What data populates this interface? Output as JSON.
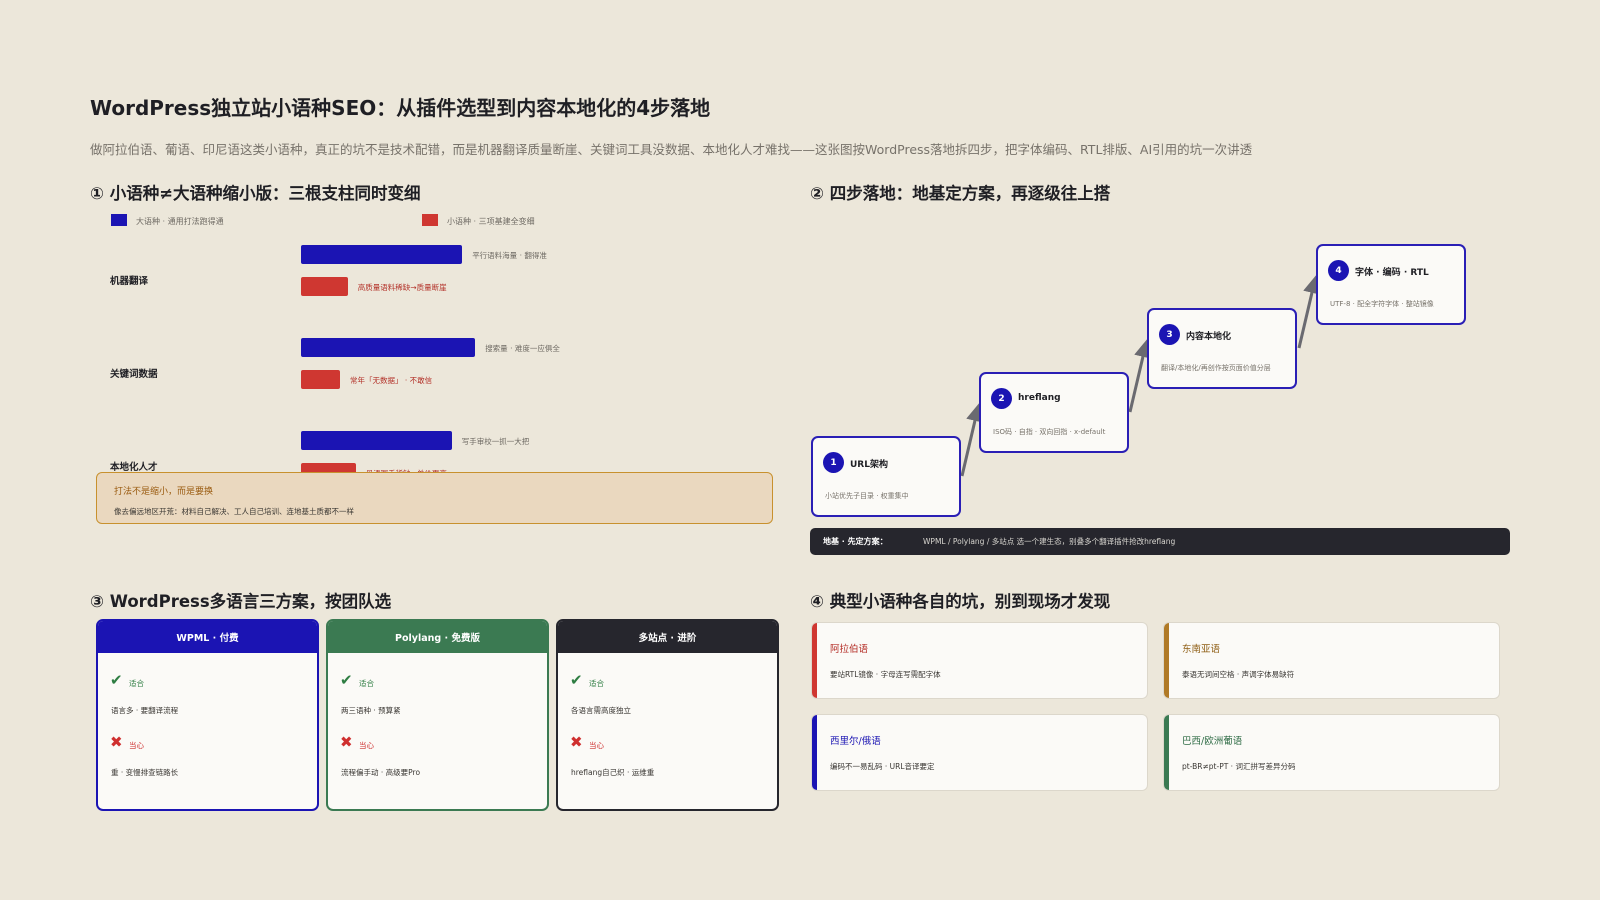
{
  "title": "WordPress独立站小语种SEO：从插件选型到内容本地化的4步落地",
  "subtitle": "做阿拉伯语、葡语、印尼语这类小语种，真正的坑不是技术配错，而是机器翻译质量断崖、关键词工具没数据、本地化人才难找——这张图按WordPress落地拆四步，把字体编码、RTL排版、AI引用的坑一次讲透",
  "colors": {
    "background": "#ece7da",
    "major": "#1b14b3",
    "minor": "#cf3731",
    "green": "#3b7a52",
    "dark": "#26262d",
    "amber": "#b07a26"
  },
  "section1": {
    "heading": "① 小语种≠大语种缩小版：三根支柱同时变细",
    "legend": [
      {
        "label": "大语种 · 通用打法跑得通",
        "color": "#1b14b3"
      },
      {
        "label": "小语种 · 三项基建全变细",
        "color": "#cf3731"
      }
    ],
    "chart_data": {
      "type": "bar",
      "title": "",
      "categories": [
        "机器翻译",
        "关键词数据",
        "本地化人才"
      ],
      "series": [
        {
          "name": "大语种 · 通用打法跑得通",
          "values": [
            62,
            67,
            58
          ]
        },
        {
          "name": "小语种 · 三项基建全变细",
          "values": [
            18,
            15,
            21
          ]
        }
      ],
      "annotations": {
        "major": [
          "平行语料海量 · 翻得准",
          "搜索量 · 难度一应俱全",
          "写手审校一抓一大把"
        ],
        "minor": [
          "高质量语料稀缺→质量断崖",
          "常年「无数据」 · 不敢信",
          "母语写手稀缺→单价更高"
        ]
      },
      "grid": false,
      "legend_position": "top"
    },
    "callout": {
      "title": "打法不是缩小，而是要换",
      "body": "像去偏远地区开荒：材料自己解决、工人自己培训、连地基土质都不一样"
    }
  },
  "section2": {
    "heading": "② 四步落地：地基定方案，再逐级往上搭",
    "steps": [
      {
        "num": "1",
        "title": "URL架构",
        "desc": "小站优先子目录 · 权重集中"
      },
      {
        "num": "2",
        "title": "hreflang",
        "desc": "ISO码 · 自指 · 双向回指 · x-default"
      },
      {
        "num": "3",
        "title": "内容本地化",
        "desc": "翻译/本地化/再创作按页面价值分层"
      },
      {
        "num": "4",
        "title": "字体 · 编码 · RTL",
        "desc": "UTF-8 · 配全字符字体 · 整站镜像"
      }
    ],
    "base": {
      "label": "地基 · 先定方案：",
      "text": "WPML / Polylang / 多站点 选一个建生态，别叠多个翻译插件抢改hreflang"
    }
  },
  "section3": {
    "heading": "③ WordPress多语言三方案，按团队选",
    "plans": [
      {
        "name": "WPML · 付费",
        "color": "#1b14b3",
        "ok_tag": "适合",
        "ok_text": "语言多 · 要翻译流程",
        "no_tag": "当心",
        "no_text": "重 · 变慢排查链路长"
      },
      {
        "name": "Polylang · 免费版",
        "color": "#3b7a52",
        "ok_tag": "适合",
        "ok_text": "两三语种 · 预算紧",
        "no_tag": "当心",
        "no_text": "流程偏手动 · 高级要Pro"
      },
      {
        "name": "多站点 · 进阶",
        "color": "#26262d",
        "ok_tag": "适合",
        "ok_text": "各语言需高度独立",
        "no_tag": "当心",
        "no_text": "hreflang自己织 · 运维重"
      }
    ]
  },
  "section4": {
    "heading": "④ 典型小语种各自的坑，别到现场才发现",
    "pits": [
      {
        "title": "阿拉伯语",
        "desc": "要站RTL镜像 · 字母连写需配字体",
        "color": "#cf3731"
      },
      {
        "title": "东南亚语",
        "desc": "泰语无词间空格 · 声调字体易缺符",
        "color": "#b07a26"
      },
      {
        "title": "西里尔/俄语",
        "desc": "编码不一易乱码 · URL音译要定",
        "color": "#1b14b3"
      },
      {
        "title": "巴西/欧洲葡语",
        "desc": "pt-BR≠pt-PT · 词汇拼写差异分码",
        "color": "#3b7a52"
      }
    ]
  }
}
